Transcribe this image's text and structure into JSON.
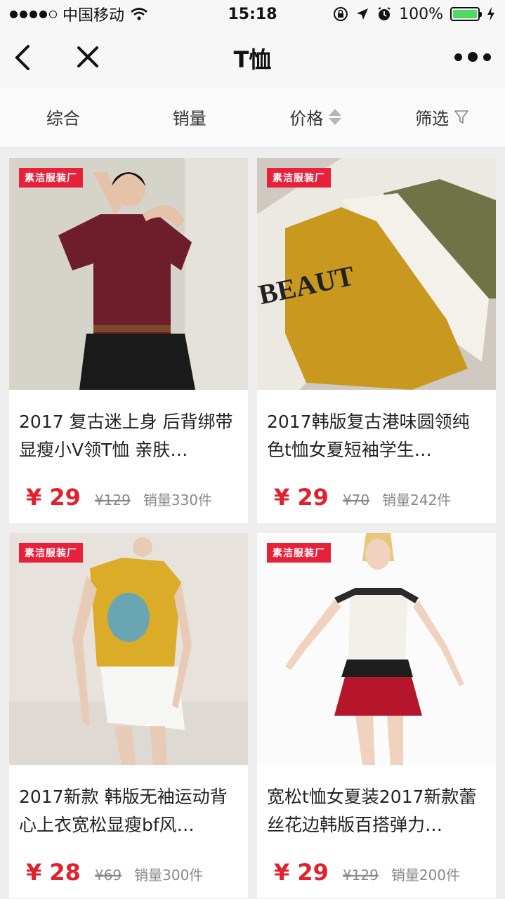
{
  "status_bar": {
    "carrier": "中国移动",
    "time": "15:18",
    "battery": "100%"
  },
  "nav": {
    "title": "T恤"
  },
  "sort_bar": {
    "items": [
      "综合",
      "销量",
      "价格",
      "筛选"
    ]
  },
  "products": [
    {
      "shop": "素洁服装厂",
      "title": "2017 复古迷上身 后背绑带显瘦小V领T恤 亲肤…",
      "price": "¥ 29",
      "original_price": "¥129",
      "sales": "销量330件"
    },
    {
      "shop": "素洁服装厂",
      "title": "2017韩版复古港味圆领纯色t恤女夏短袖学生…",
      "price": "¥ 29",
      "original_price": "¥70",
      "sales": "销量242件"
    },
    {
      "shop": "素洁服装厂",
      "title": "2017新款 韩版无袖运动背心上衣宽松显瘦bf风…",
      "price": "¥ 28",
      "original_price": "¥69",
      "sales": "销量300件"
    },
    {
      "shop": "素洁服装厂",
      "title": "宽松t恤女夏装2017新款蕾丝花边韩版百搭弹力…",
      "price": "¥ 29",
      "original_price": "¥129",
      "sales": "销量200件"
    }
  ],
  "colors": {
    "price_red": "#e0222f",
    "badge_red": "#e8213b",
    "battery_green": "#4cd964"
  }
}
